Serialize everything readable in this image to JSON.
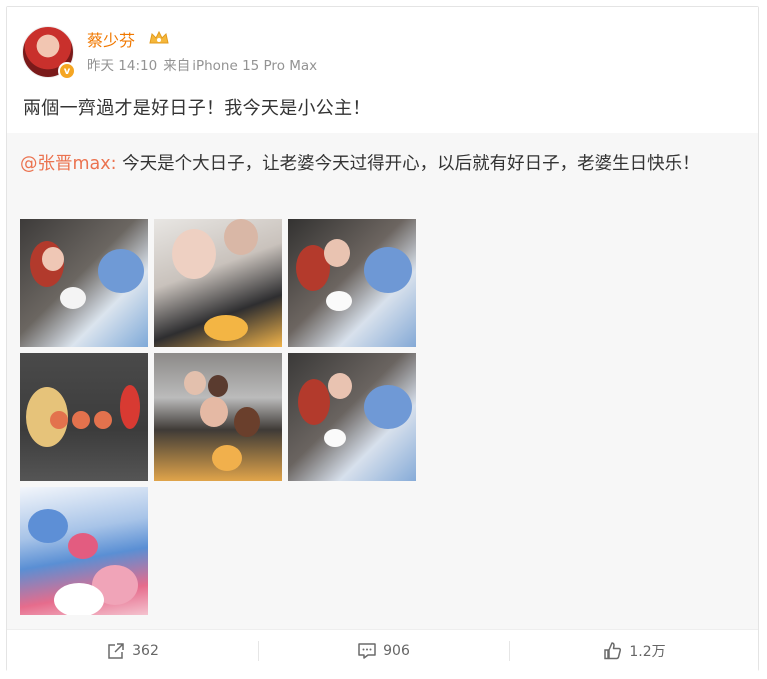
{
  "post": {
    "author": "蔡少芬",
    "time": "昨天 14:10",
    "source_prefix": "来自",
    "source": "iPhone 15 Pro Max",
    "text": "兩個一齊過才是好日子！我今天是小公主！"
  },
  "repost": {
    "mention": "@张晋max",
    "separator": ":",
    "text": " 今天是个大日子，让老婆今天过得开心，以后就有好日子，老婆生日快乐！"
  },
  "photos": [
    {
      "icon": "photo-couple-flowers"
    },
    {
      "icon": "photo-selfie"
    },
    {
      "icon": "photo-couple-cake"
    },
    {
      "icon": "photo-flowers-macarons"
    },
    {
      "icon": "photo-family"
    },
    {
      "icon": "photo-couple-bouquet"
    },
    {
      "icon": "photo-cake-flowers"
    }
  ],
  "actions": {
    "forward_count": "362",
    "comment_count": "906",
    "like_count": "1.2万"
  },
  "colors": {
    "author": "#f07800",
    "mention": "#eb7350",
    "repost_bg": "#f7f7f7",
    "verified": "#f5a623"
  }
}
